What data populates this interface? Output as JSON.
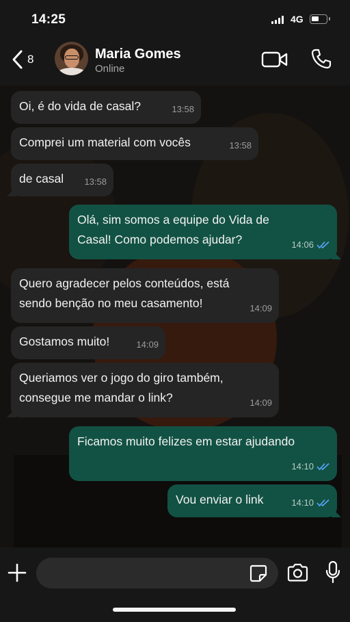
{
  "status_bar": {
    "time": "14:25",
    "network": "4G"
  },
  "header": {
    "back_count": "8",
    "contact_name": "Maria Gomes",
    "contact_status": "Online"
  },
  "messages": [
    {
      "direction": "in",
      "text": "Oi, é do vida de casal?",
      "time": "13:58"
    },
    {
      "direction": "in",
      "text": "Comprei um material com vocês",
      "time": "13:58"
    },
    {
      "direction": "in",
      "text": "de casal",
      "time": "13:58"
    },
    {
      "direction": "out",
      "line1": "Olá, sim somos a equipe do Vida de",
      "line2": "Casal! Como podemos ajudar?",
      "time": "14:06",
      "status": "read"
    },
    {
      "direction": "in",
      "line1": "Quero agradecer pelos conteúdos, está",
      "line2": "sendo benção no meu casamento!",
      "time": "14:09"
    },
    {
      "direction": "in",
      "text": "Gostamos muito!",
      "time": "14:09"
    },
    {
      "direction": "in",
      "line1": "Queriamos ver o jogo do giro também,",
      "line2": "consegue me mandar o link?",
      "time": "14:09"
    },
    {
      "direction": "out",
      "text": "Ficamos muito felizes em estar ajudando",
      "time": "14:10",
      "status": "read"
    },
    {
      "direction": "out",
      "text": "Vou enviar o link",
      "time": "14:10",
      "status": "read"
    }
  ],
  "composer": {
    "placeholder": ""
  },
  "icons": {
    "back": "chevron-left-icon",
    "video": "video-camera-icon",
    "call": "phone-icon",
    "plus": "plus-icon",
    "sticker": "sticker-icon",
    "camera": "camera-icon",
    "mic": "microphone-icon",
    "read": "double-check-icon"
  },
  "colors": {
    "incoming_bubble": "#252525",
    "outgoing_bubble": "#125244",
    "read_ticks": "#5aa7ff"
  }
}
